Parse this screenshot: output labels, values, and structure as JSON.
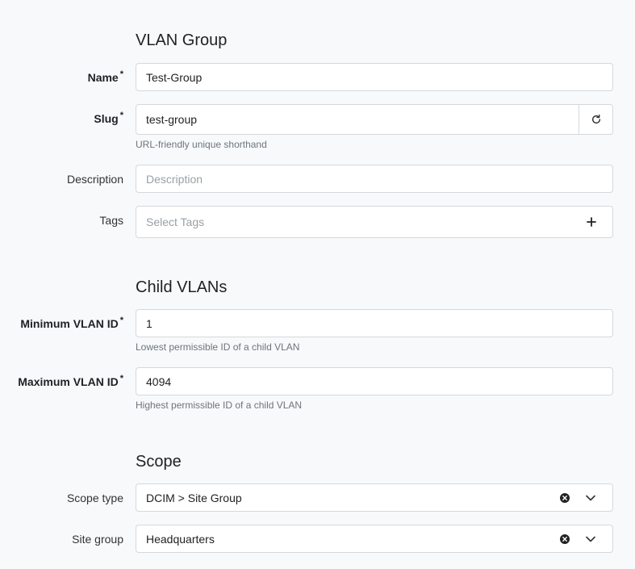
{
  "sections": {
    "vlan_group": "VLAN Group",
    "child_vlans": "Child VLANs",
    "scope": "Scope"
  },
  "fields": {
    "name": {
      "label": "Name",
      "value": "Test-Group",
      "required_mark": "*"
    },
    "slug": {
      "label": "Slug",
      "value": "test-group",
      "required_mark": "*",
      "help": "URL-friendly unique shorthand",
      "action_icon": "refresh-icon"
    },
    "description": {
      "label": "Description",
      "placeholder": "Description"
    },
    "tags": {
      "label": "Tags",
      "placeholder": "Select Tags",
      "action_icon": "plus-icon"
    },
    "min_vid": {
      "label": "Minimum VLAN ID",
      "value": "1",
      "required_mark": "*",
      "help": "Lowest permissible ID of a child VLAN"
    },
    "max_vid": {
      "label": "Maximum VLAN ID",
      "value": "4094",
      "required_mark": "*",
      "help": "Highest permissible ID of a child VLAN"
    },
    "scope_type": {
      "label": "Scope type",
      "value": "DCIM > Site Group",
      "clear_icon": "clear-icon",
      "dropdown_icon": "chevron-down-icon"
    },
    "site_group": {
      "label": "Site group",
      "value": "Headquarters",
      "clear_icon": "clear-icon",
      "dropdown_icon": "chevron-down-icon"
    }
  }
}
